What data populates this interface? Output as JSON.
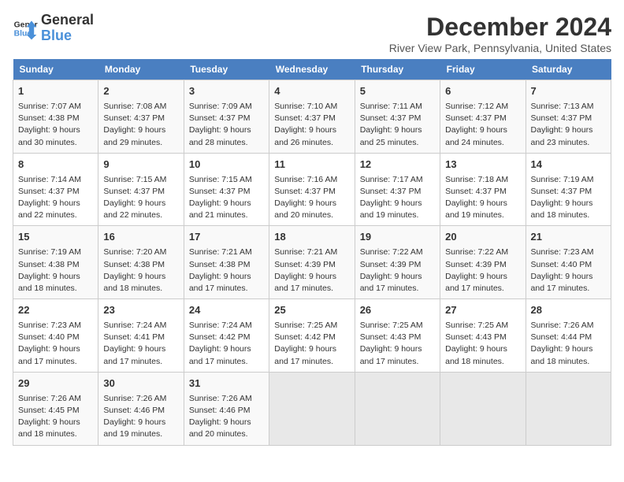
{
  "header": {
    "logo_line1": "General",
    "logo_line2": "Blue",
    "month_year": "December 2024",
    "location": "River View Park, Pennsylvania, United States"
  },
  "days_of_week": [
    "Sunday",
    "Monday",
    "Tuesday",
    "Wednesday",
    "Thursday",
    "Friday",
    "Saturday"
  ],
  "weeks": [
    [
      {
        "day": "1",
        "info": "Sunrise: 7:07 AM\nSunset: 4:38 PM\nDaylight: 9 hours\nand 30 minutes."
      },
      {
        "day": "2",
        "info": "Sunrise: 7:08 AM\nSunset: 4:37 PM\nDaylight: 9 hours\nand 29 minutes."
      },
      {
        "day": "3",
        "info": "Sunrise: 7:09 AM\nSunset: 4:37 PM\nDaylight: 9 hours\nand 28 minutes."
      },
      {
        "day": "4",
        "info": "Sunrise: 7:10 AM\nSunset: 4:37 PM\nDaylight: 9 hours\nand 26 minutes."
      },
      {
        "day": "5",
        "info": "Sunrise: 7:11 AM\nSunset: 4:37 PM\nDaylight: 9 hours\nand 25 minutes."
      },
      {
        "day": "6",
        "info": "Sunrise: 7:12 AM\nSunset: 4:37 PM\nDaylight: 9 hours\nand 24 minutes."
      },
      {
        "day": "7",
        "info": "Sunrise: 7:13 AM\nSunset: 4:37 PM\nDaylight: 9 hours\nand 23 minutes."
      }
    ],
    [
      {
        "day": "8",
        "info": "Sunrise: 7:14 AM\nSunset: 4:37 PM\nDaylight: 9 hours\nand 22 minutes."
      },
      {
        "day": "9",
        "info": "Sunrise: 7:15 AM\nSunset: 4:37 PM\nDaylight: 9 hours\nand 22 minutes."
      },
      {
        "day": "10",
        "info": "Sunrise: 7:15 AM\nSunset: 4:37 PM\nDaylight: 9 hours\nand 21 minutes."
      },
      {
        "day": "11",
        "info": "Sunrise: 7:16 AM\nSunset: 4:37 PM\nDaylight: 9 hours\nand 20 minutes."
      },
      {
        "day": "12",
        "info": "Sunrise: 7:17 AM\nSunset: 4:37 PM\nDaylight: 9 hours\nand 19 minutes."
      },
      {
        "day": "13",
        "info": "Sunrise: 7:18 AM\nSunset: 4:37 PM\nDaylight: 9 hours\nand 19 minutes."
      },
      {
        "day": "14",
        "info": "Sunrise: 7:19 AM\nSunset: 4:37 PM\nDaylight: 9 hours\nand 18 minutes."
      }
    ],
    [
      {
        "day": "15",
        "info": "Sunrise: 7:19 AM\nSunset: 4:38 PM\nDaylight: 9 hours\nand 18 minutes."
      },
      {
        "day": "16",
        "info": "Sunrise: 7:20 AM\nSunset: 4:38 PM\nDaylight: 9 hours\nand 18 minutes."
      },
      {
        "day": "17",
        "info": "Sunrise: 7:21 AM\nSunset: 4:38 PM\nDaylight: 9 hours\nand 17 minutes."
      },
      {
        "day": "18",
        "info": "Sunrise: 7:21 AM\nSunset: 4:39 PM\nDaylight: 9 hours\nand 17 minutes."
      },
      {
        "day": "19",
        "info": "Sunrise: 7:22 AM\nSunset: 4:39 PM\nDaylight: 9 hours\nand 17 minutes."
      },
      {
        "day": "20",
        "info": "Sunrise: 7:22 AM\nSunset: 4:39 PM\nDaylight: 9 hours\nand 17 minutes."
      },
      {
        "day": "21",
        "info": "Sunrise: 7:23 AM\nSunset: 4:40 PM\nDaylight: 9 hours\nand 17 minutes."
      }
    ],
    [
      {
        "day": "22",
        "info": "Sunrise: 7:23 AM\nSunset: 4:40 PM\nDaylight: 9 hours\nand 17 minutes."
      },
      {
        "day": "23",
        "info": "Sunrise: 7:24 AM\nSunset: 4:41 PM\nDaylight: 9 hours\nand 17 minutes."
      },
      {
        "day": "24",
        "info": "Sunrise: 7:24 AM\nSunset: 4:42 PM\nDaylight: 9 hours\nand 17 minutes."
      },
      {
        "day": "25",
        "info": "Sunrise: 7:25 AM\nSunset: 4:42 PM\nDaylight: 9 hours\nand 17 minutes."
      },
      {
        "day": "26",
        "info": "Sunrise: 7:25 AM\nSunset: 4:43 PM\nDaylight: 9 hours\nand 17 minutes."
      },
      {
        "day": "27",
        "info": "Sunrise: 7:25 AM\nSunset: 4:43 PM\nDaylight: 9 hours\nand 18 minutes."
      },
      {
        "day": "28",
        "info": "Sunrise: 7:26 AM\nSunset: 4:44 PM\nDaylight: 9 hours\nand 18 minutes."
      }
    ],
    [
      {
        "day": "29",
        "info": "Sunrise: 7:26 AM\nSunset: 4:45 PM\nDaylight: 9 hours\nand 18 minutes."
      },
      {
        "day": "30",
        "info": "Sunrise: 7:26 AM\nSunset: 4:46 PM\nDaylight: 9 hours\nand 19 minutes."
      },
      {
        "day": "31",
        "info": "Sunrise: 7:26 AM\nSunset: 4:46 PM\nDaylight: 9 hours\nand 20 minutes."
      },
      {
        "day": "",
        "info": ""
      },
      {
        "day": "",
        "info": ""
      },
      {
        "day": "",
        "info": ""
      },
      {
        "day": "",
        "info": ""
      }
    ]
  ]
}
